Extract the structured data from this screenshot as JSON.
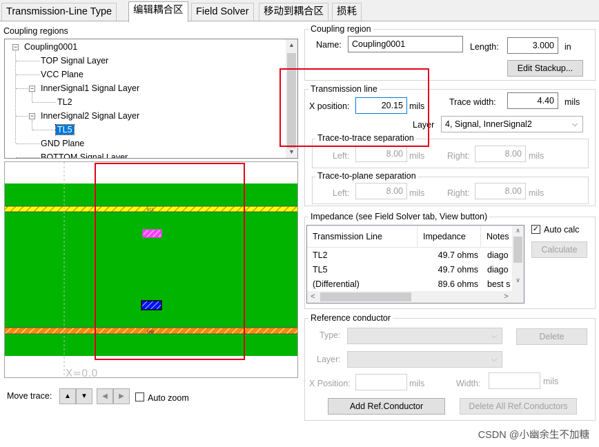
{
  "tabs": [
    {
      "label": "Transmission-Line Type",
      "active": false
    },
    {
      "label": "编辑耦合区",
      "active": true
    },
    {
      "label": "Field Solver",
      "active": false
    },
    {
      "label": "移动到耦合区",
      "active": false
    },
    {
      "label": "损耗",
      "active": false
    }
  ],
  "coupling_regions": {
    "title": "Coupling regions",
    "tree": {
      "root": "Coupling0001",
      "items": [
        "TOP Signal Layer",
        "VCC Plane",
        "InnerSignal1 Signal Layer",
        "TL2",
        "InnerSignal2 Signal Layer",
        "TL5",
        "GND Plane",
        "BOTTOM Signal Layer"
      ]
    }
  },
  "drawing": {
    "vcc_label": "VCC",
    "gnd_label": "GND",
    "x_readout": "X=0.0",
    "colors": {
      "dielectric": "#00b400",
      "vcc_plane": "#ffff00",
      "gnd_plane": "#ff8a00",
      "trace_tl2": "#ff40ff",
      "trace_tl5": "#0010ff"
    }
  },
  "move_trace": {
    "label": "Move trace:",
    "up_icon": "up-arrow-icon",
    "down_icon": "down-arrow-icon",
    "left_icon": "left-arrow-icon",
    "right_icon": "right-arrow-icon",
    "auto_zoom_label": "Auto zoom",
    "auto_zoom_checked": false
  },
  "coupling_region": {
    "title": "Coupling region",
    "name_label": "Name:",
    "name_value": "Coupling0001",
    "length_label": "Length:",
    "length_value": "3.000",
    "length_unit": "in",
    "edit_stackup_label": "Edit Stackup..."
  },
  "transmission_line": {
    "title": "Transmission line",
    "x_position_label": "X position:",
    "x_position_value": "20.15",
    "x_position_unit": "mils",
    "trace_width_label": "Trace width:",
    "trace_width_value": "4.40",
    "trace_width_unit": "mils",
    "layer_label": "Layer",
    "layer_value": "4, Signal, InnerSignal2",
    "trace_sep": {
      "title": "Trace-to-trace separation",
      "left_label": "Left:",
      "left_value": "8.00",
      "left_unit": "mils",
      "right_label": "Right:",
      "right_value": "8.00",
      "right_unit": "mils"
    },
    "plane_sep": {
      "title": "Trace-to-plane separation",
      "left_label": "Left:",
      "left_value": "8.00",
      "left_unit": "mils",
      "right_label": "Right:",
      "right_value": "8.00",
      "right_unit": "mils"
    }
  },
  "impedance": {
    "title": "Impedance (see Field Solver tab, View button)",
    "columns": [
      "Transmission Line",
      "Impedance",
      "Notes"
    ],
    "rows": [
      [
        "TL2",
        "49.7 ohms",
        "diago"
      ],
      [
        "TL5",
        "49.7 ohms",
        "diago"
      ],
      [
        "(Differential)",
        "89.6 ohms",
        "best s"
      ]
    ],
    "auto_calc_label": "Auto calc",
    "auto_calc_checked": true,
    "calculate_label": "Calculate"
  },
  "reference_conductor": {
    "title": "Reference conductor",
    "type_label": "Type:",
    "delete_label": "Delete",
    "layer_label": "Layer:",
    "x_position_label": "X Position:",
    "x_position_unit": "mils",
    "width_label": "Width:",
    "width_unit": "mils",
    "add_label": "Add Ref.Conductor",
    "delete_all_label": "Delete All Ref.Conductors"
  },
  "watermark": "CSDN @小幽余生不加糖"
}
